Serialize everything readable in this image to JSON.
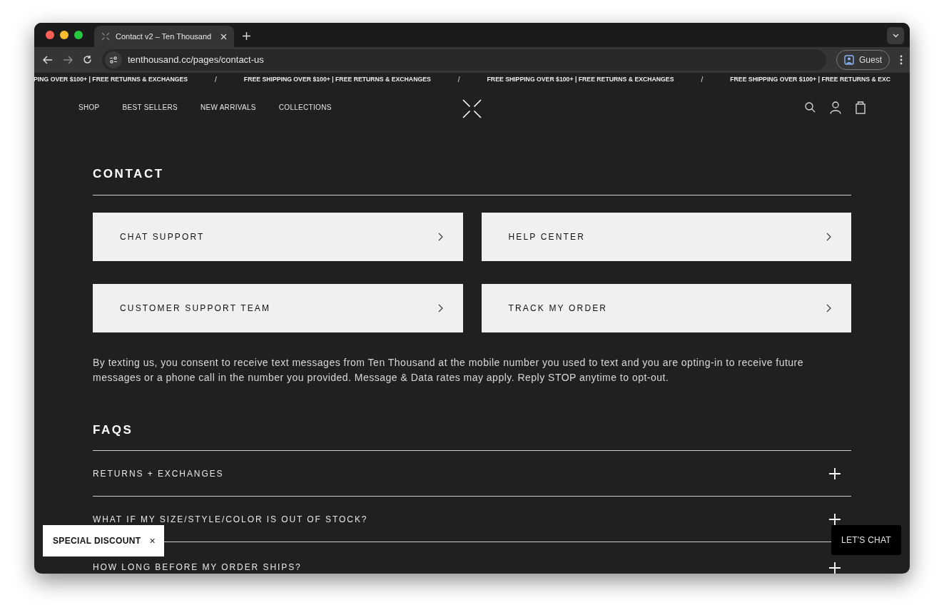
{
  "browser": {
    "tab_title": "Contact v2 – Ten Thousand",
    "url": "tenthousand.cc/pages/contact-us",
    "profile": "Guest"
  },
  "announcement": [
    {
      "kind": "message",
      "text": "PING OVER $100+ | FREE RETURNS & EXCHANGES"
    },
    {
      "kind": "separator",
      "text": "/"
    },
    {
      "kind": "message",
      "text": "FREE SHIPPING OVER $100+ | FREE RETURNS & EXCHANGES"
    },
    {
      "kind": "separator",
      "text": "/"
    },
    {
      "kind": "message",
      "text": "FREE SHIPPING OVER $100+ | FREE RETURNS & EXCHANGES"
    },
    {
      "kind": "separator",
      "text": "/"
    },
    {
      "kind": "message",
      "text": "FREE SHIPPING OVER $100+ | FREE RETURNS & EXC"
    }
  ],
  "nav": {
    "links": [
      "SHOP",
      "BEST SELLERS",
      "NEW ARRIVALS",
      "COLLECTIONS"
    ]
  },
  "contact": {
    "heading": "CONTACT",
    "cards": [
      "CHAT SUPPORT",
      "HELP CENTER",
      "CUSTOMER SUPPORT TEAM",
      "TRACK MY ORDER"
    ],
    "consent": "By texting us, you consent to receive text messages from Ten Thousand at the mobile number you used to text and you are opting-in to receive future messages or a phone call in the number you provided. Message & Data rates may apply. Reply STOP anytime to opt-out."
  },
  "faqs": {
    "heading": "FAQS",
    "items": [
      {
        "question": "RETURNS + EXCHANGES",
        "expanded": false
      },
      {
        "question": "WHAT IF MY SIZE/STYLE/COLOR IS OUT OF STOCK?",
        "expanded": false
      },
      {
        "question": "HOW LONG BEFORE MY ORDER SHIPS?",
        "expanded": false
      }
    ]
  },
  "popups": {
    "discount": {
      "label": "SPECIAL DISCOUNT",
      "close": "×"
    },
    "chat": "LET'S CHAT"
  }
}
